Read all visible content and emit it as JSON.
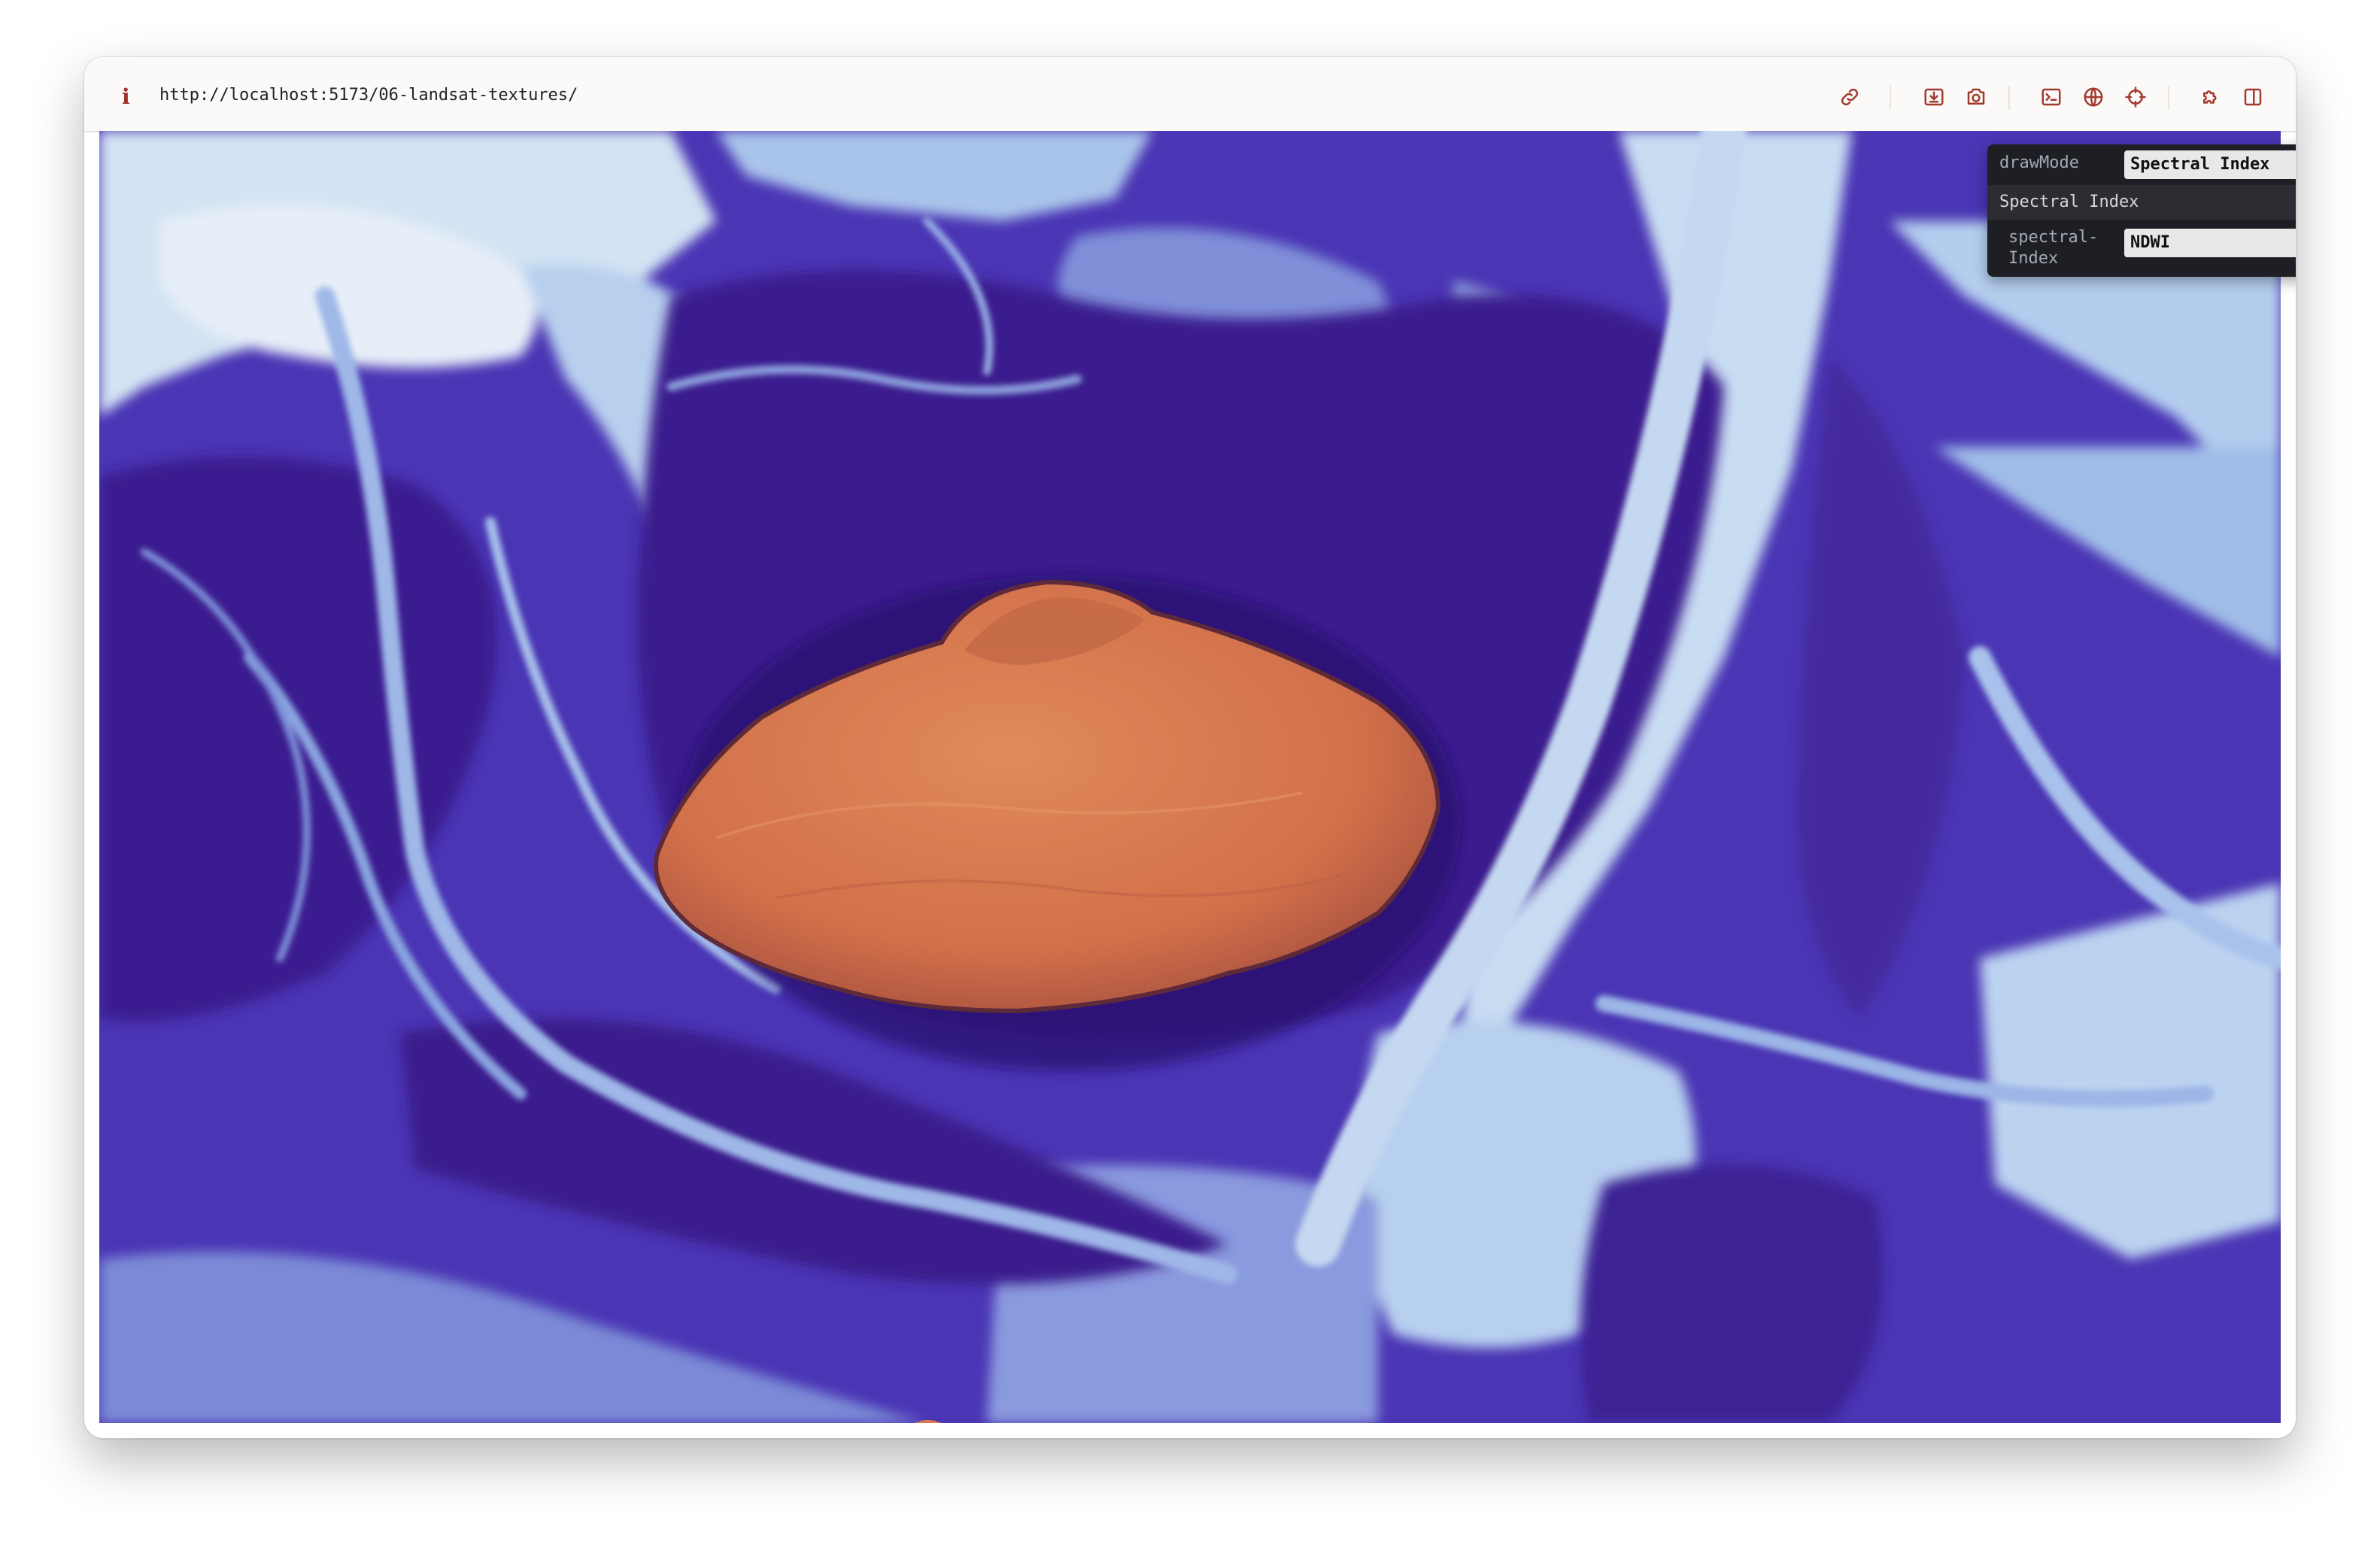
{
  "browser": {
    "url": "http://localhost:5173/06-landsat-textures/",
    "toolbar_icons": [
      "link-icon",
      "download-icon",
      "camera-icon",
      "terminal-icon",
      "globe-icon",
      "crosshair-icon",
      "extensions-icon",
      "sidebar-icon"
    ]
  },
  "controls": {
    "draw_mode_label": "drawMode",
    "draw_mode_value": "Spectral Index",
    "folder_title": "Spectral Index",
    "spectral_index_label_line1": "spectral-",
    "spectral_index_label_line2": "Index",
    "spectral_index_value": "NDWI"
  },
  "colors": {
    "water_orange": "#d9774d",
    "deep_purple": "#3b1c8f",
    "mid_purple": "#5a4cc4",
    "light_blue": "#a9c6ea",
    "pale": "#dde9f5",
    "panel_bg": "#1e1f24"
  }
}
